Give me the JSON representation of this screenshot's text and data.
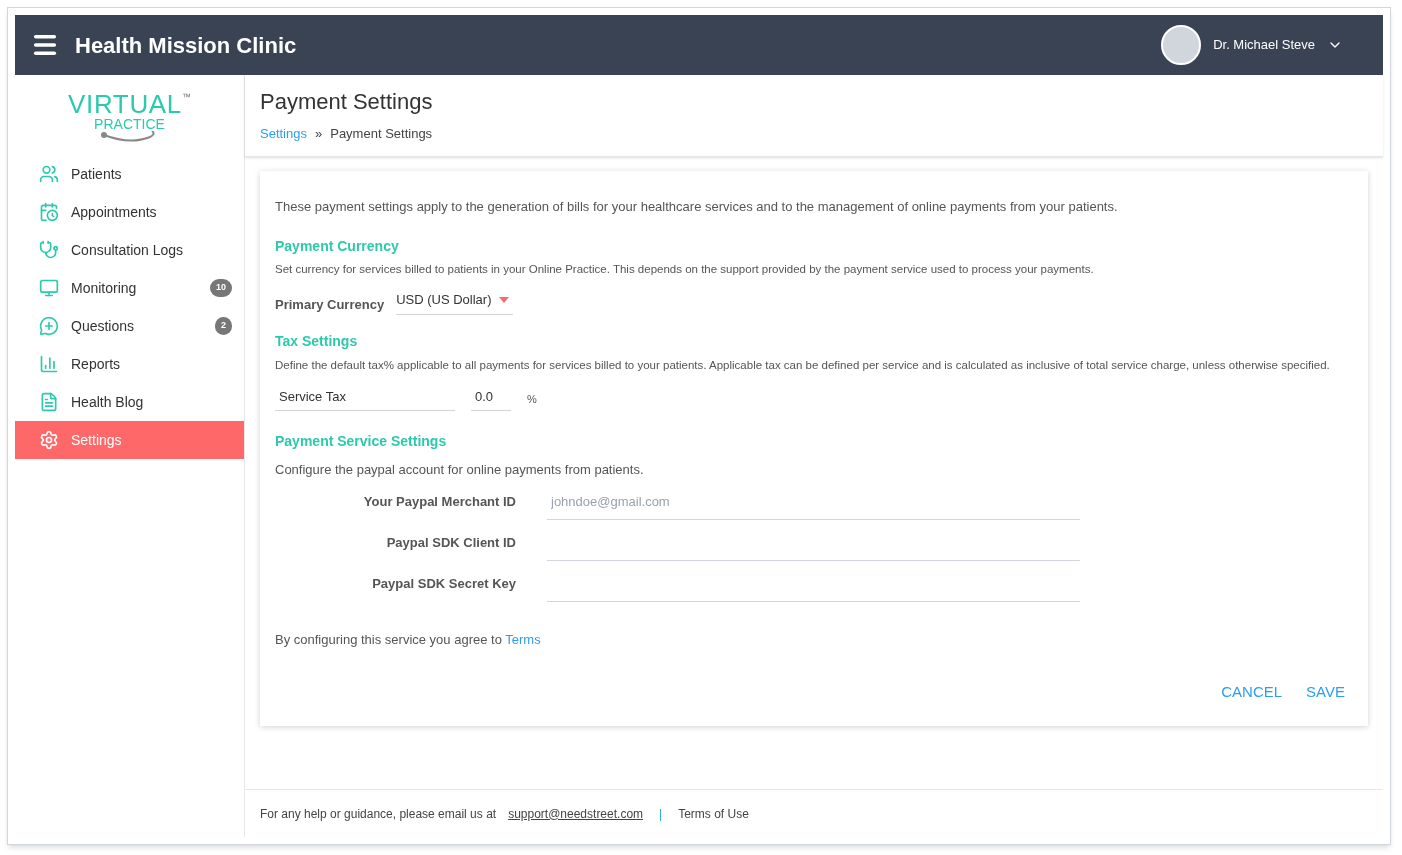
{
  "header": {
    "title": "Health Mission Clinic",
    "user": "Dr. Michael Steve"
  },
  "logo": {
    "line1": "VIRTUAL",
    "line2": "PRACTICE",
    "mark": "™"
  },
  "sidebar": {
    "items": [
      {
        "label": "Patients",
        "selected": false
      },
      {
        "label": "Appointments",
        "selected": false
      },
      {
        "label": "Consultation Logs",
        "selected": false
      },
      {
        "label": "Monitoring",
        "selected": false,
        "badge": "10"
      },
      {
        "label": "Questions",
        "selected": false,
        "badge": "2"
      },
      {
        "label": "Reports",
        "selected": false
      },
      {
        "label": "Health Blog",
        "selected": false
      },
      {
        "label": "Settings",
        "selected": true
      }
    ]
  },
  "page": {
    "title": "Payment Settings",
    "breadcrumb": [
      {
        "label": "Settings",
        "link": true
      },
      {
        "label": "»",
        "link": false
      },
      {
        "label": "Payment Settings",
        "link": false
      }
    ]
  },
  "card": {
    "intro": "These payment settings apply to the generation of bills for your healthcare services and to the management of online payments from your patients.",
    "currency": {
      "heading": "Payment Currency",
      "description": "Set currency for services billed to patients in your Online Practice. This depends on the support provided by the payment service used to process your payments.",
      "label": "Primary Currency",
      "value": "USD (US Dollar)"
    },
    "tax": {
      "heading": "Tax Settings",
      "description": "Define the default tax% applicable to all payments for services billed to your patients. Applicable tax can be defined per service and is calculated as inclusive of total service charge, unless otherwise specified.",
      "name": "Service Tax",
      "value": "0.0",
      "unit": "%"
    },
    "service": {
      "heading": "Payment Service Settings",
      "description": "Configure the paypal account for online payments from patients.",
      "fields": [
        {
          "label": "Your Paypal Merchant ID",
          "placeholder": "johndoe@gmail.com"
        },
        {
          "label": "Paypal SDK Client ID"
        },
        {
          "label": "Paypal SDK Secret Key"
        }
      ],
      "agree": "By configuring this service you agree to",
      "terms": "Terms"
    },
    "buttons": [
      "CANCEL",
      "SAVE"
    ]
  },
  "footer": {
    "text": "For any help or guidance, please email us at",
    "email": "support@needstreet.com",
    "separator": "|",
    "link": "Terms of Use"
  }
}
